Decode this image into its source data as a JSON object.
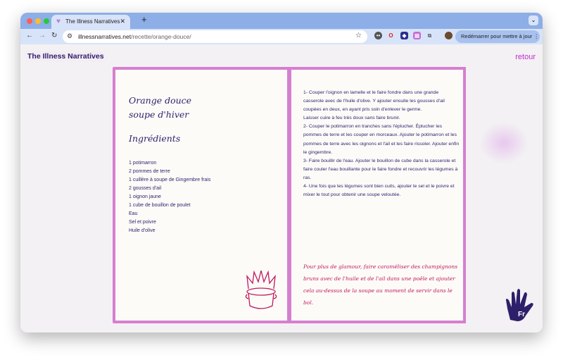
{
  "browser": {
    "tab_title": "The Illness Narratives",
    "url_domain": "illnessnarratives.net",
    "url_path": "/recette/orange-douce/",
    "update_button": "Redémarrer pour mettre à jour"
  },
  "site": {
    "brand": "The Illness Narratives",
    "back_link": "retour",
    "language_badge": "Fr"
  },
  "recipe": {
    "title_line1": "Orange douce",
    "title_line2": "soupe d'hiver",
    "ingredients_heading": "Ingrédients",
    "ingredients": [
      "1 potimarron",
      "2 pommes de terre",
      "1 cuillère à soupe de Gingembre frais",
      "2 gousses d'ail",
      "1 oignon jaune",
      "1 cube de bouillon de poulet",
      "Eau",
      "Sel et poivre",
      "Huile d'olive"
    ],
    "steps": [
      "1- Couper l'oignon en lamelle et le faire fondre dans une grande casserole avec de l'huile d'olive. Y ajouter ensuite les gousses d'ail coupées en deux, en ayant pris soin d'enlever le germe.",
      "Laisser cuire à feu très doux sans faire brunir.",
      "2- Couper le potimarron en tranches sans l'éplucher. Éplucher les pommes de terre et les couper en morceaux. Ajouter le potimarron et les pommes de terre avec les oignons et l'ail et les faire rissoler. Ajouter enfin le gingembre.",
      "3- Faire bouillir de l'eau. Ajouter le bouillon de cube dans la casserole et faire couler l'eau bouillante pour le faire fondre et recouvrir les légumes à ras.",
      "4- Une fois que les légumes sont bien cuits, ajouter le sel et le poivre et mixer le tout pour obtenir une soupe veloutée."
    ],
    "tip": "Pour plus de glamour, faire caramëliser des champignons bruns avec de l'huile et de l'ail dans une poêle et ajouter cela au-dessus de la soupe au moment de servir dans le bol."
  },
  "colors": {
    "accent": "#c02bd0",
    "ink": "#2e1f6b",
    "border": "#d57fd0",
    "tip": "#c2195f"
  }
}
